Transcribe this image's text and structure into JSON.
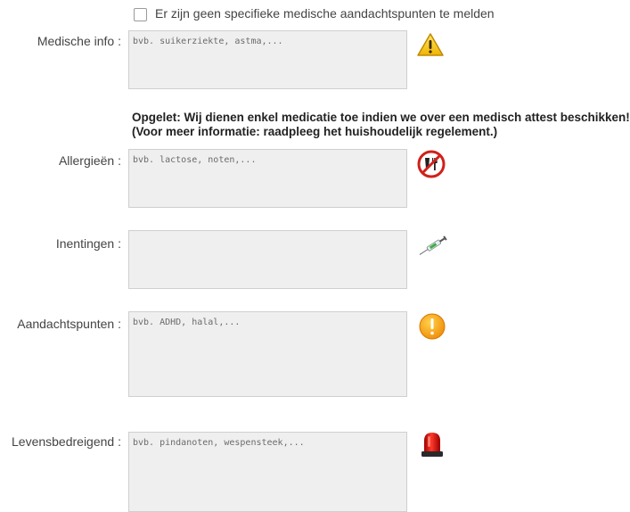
{
  "checkbox": {
    "label": "Er zijn geen specifieke medische aandachtspunten te melden",
    "checked": false
  },
  "fields": {
    "medische_info": {
      "label": "Medische info :",
      "placeholder": "bvb. suikerziekte, astma,...",
      "value": "",
      "icon": "warning-triangle-icon"
    },
    "allergieen": {
      "label": "Allergieën :",
      "placeholder": "bvb. lactose, noten,...",
      "value": "",
      "icon": "no-food-drink-icon"
    },
    "inentingen": {
      "label": "Inentingen :",
      "placeholder": "",
      "value": "",
      "icon": "syringe-icon"
    },
    "aandachtspunten": {
      "label": "Aandachtspunten :",
      "placeholder": "bvb. ADHD, halal,...",
      "value": "",
      "icon": "exclamation-circle-icon"
    },
    "levensbedreigend": {
      "label": "Levensbedreigend :",
      "placeholder": "bvb. pindanoten, wespensteek,...",
      "value": "",
      "icon": "siren-light-icon"
    }
  },
  "notice": {
    "line1": "Opgelet: Wij dienen enkel medicatie toe indien we over een medisch attest beschikken!",
    "line2": "(Voor meer informatie: raadpleeg het huishoudelijk regelement.)"
  },
  "colors": {
    "field_bg": "#efefef",
    "warning_yellow": "#f5c400",
    "prohibition_red": "#d0201a",
    "alert_orange": "#f6a21a",
    "siren_red": "#d41f1f"
  }
}
